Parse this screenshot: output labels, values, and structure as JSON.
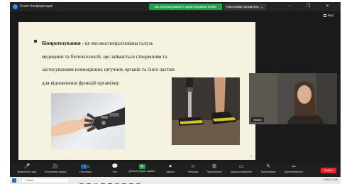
{
  "titlebar": {
    "app_title": "Zoom Конференция",
    "share_banner": "Вы просматриваете экран Bogdana Nelda",
    "view_options": "Настройки просмотра",
    "window_controls": "–  ❐  ✕"
  },
  "view_label": "Вид",
  "slide": {
    "term": "Біопротезування",
    "line1_rest": " -  це високоспеціалізована галузь",
    "line2": "медицини та біотехнологій, що займається створенням та",
    "line3": "застосуванням повноцінних штучних органів та їхніх частин",
    "line4": "для відновлення функцій організму.",
    "page_number": "3"
  },
  "participant": {
    "name": "Ирина"
  },
  "toolbar": {
    "buttons": [
      {
        "icon": "🎤",
        "label": "Выключить звук"
      },
      {
        "icon": "🎥",
        "label": "Остановить видео"
      },
      {
        "icon": "👥",
        "label": "Участники",
        "badge": "40"
      },
      {
        "icon": "💬",
        "label": "Чат"
      },
      {
        "icon": "▲",
        "label": "Демонстрация экрана"
      },
      {
        "icon": "⏺",
        "label": "Запись"
      },
      {
        "icon": "☺",
        "label": "Реакции"
      },
      {
        "icon": "⊞",
        "label": "Приложения"
      },
      {
        "icon": "▭",
        "label": "Доска сообщений"
      },
      {
        "icon": "✎",
        "label": "Примечания"
      },
      {
        "icon": "•••",
        "label": "Дополнительно"
      }
    ],
    "leave": "Выйти"
  },
  "taskbar": {
    "search_placeholder": "Поиск",
    "tray": "^ ENG 12:00",
    "colors": [
      "#6a6a6a",
      "#1b6fd8",
      "#e6a100",
      "#1b6fd8",
      "#0b7a3e",
      "#2d8cff",
      "#d33",
      "#1b6fd8",
      "#0a8"
    ]
  }
}
